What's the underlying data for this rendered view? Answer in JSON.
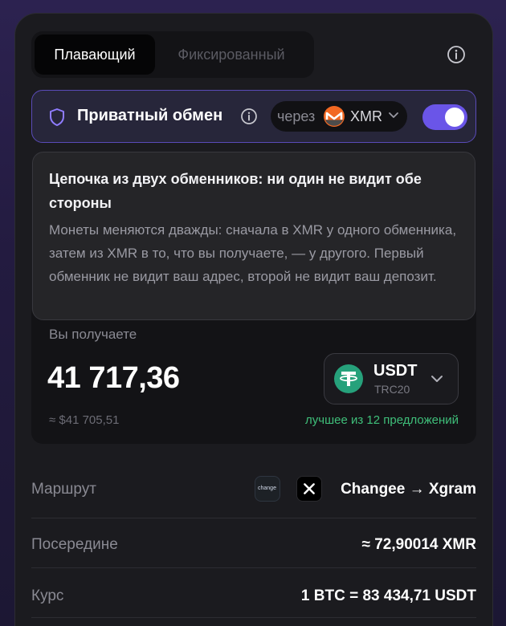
{
  "mode_tabs": {
    "floating": "Плавающий",
    "fixed": "Фиксированный"
  },
  "private": {
    "label": "Приватный обмен",
    "via_label": "через",
    "via_coin": "XMR",
    "toggle_on": true
  },
  "tooltip": {
    "title": "Цепочка из двух обменников: ни один не видит обе стороны",
    "body": "Монеты меняются дважды: сначала в XMR у одного обменника, затем из XMR в то, что вы получаете, — у другого. Первый обменник не видит ваш адрес, второй не видит ваш депозит."
  },
  "receive": {
    "label": "Вы получаете",
    "amount": "41 717,36",
    "usd_value": "≈ $41 705,51",
    "best_offers": "лучшее из 12 предложений",
    "coin": "USDT",
    "network": "TRC20"
  },
  "rows": {
    "route_label": "Маршрут",
    "route_value": "Changee → Xgram",
    "changee_logo_text": "change",
    "mid_label": "Посередине",
    "mid_value": "≈ 72,90014 XMR",
    "rate_label": "Курс",
    "rate_value": "1 BTC = 83 434,71 USDT"
  },
  "colors": {
    "accent": "#6a55e8",
    "success": "#3fbf7a",
    "monero_orange": "#f26822",
    "tether_green": "#26a17b"
  },
  "icons": {
    "info": "info-icon",
    "shield": "shield-icon",
    "chevron": "chevron-down-icon"
  }
}
